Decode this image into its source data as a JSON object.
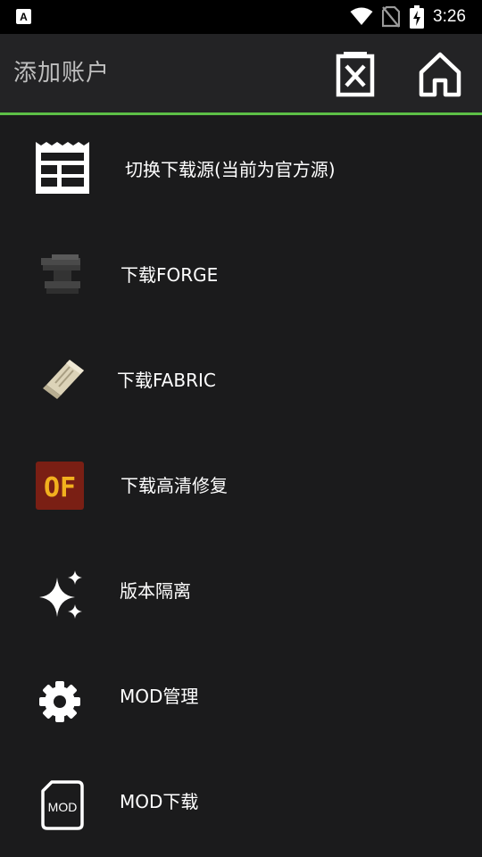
{
  "status_bar": {
    "time": "3:26",
    "icons": [
      "app-icon",
      "wifi-icon",
      "no-sim-icon",
      "battery-charging-icon"
    ]
  },
  "app_bar": {
    "title": "添加账户",
    "actions": [
      "delete-icon",
      "home-icon"
    ]
  },
  "colors": {
    "background": "#1b1b1c",
    "app_bar": "#232325",
    "accent_line": "#5dc046",
    "title_text": "#bfbfbf"
  },
  "menu": {
    "items": [
      {
        "label": "切换下载源(当前为官方源)",
        "icon": "news-icon"
      },
      {
        "label": "下载FORGE",
        "icon": "anvil-icon"
      },
      {
        "label": "下载FABRIC",
        "icon": "fabric-scroll-icon"
      },
      {
        "label": "下载高清修复",
        "icon": "optifine-icon",
        "icon_text": "OF"
      },
      {
        "label": "版本隔离",
        "icon": "sparkle-icon"
      },
      {
        "label": "MOD管理",
        "icon": "gear-icon"
      },
      {
        "label": "MOD下载",
        "icon": "mod-file-icon",
        "icon_text": "MOD"
      }
    ]
  }
}
